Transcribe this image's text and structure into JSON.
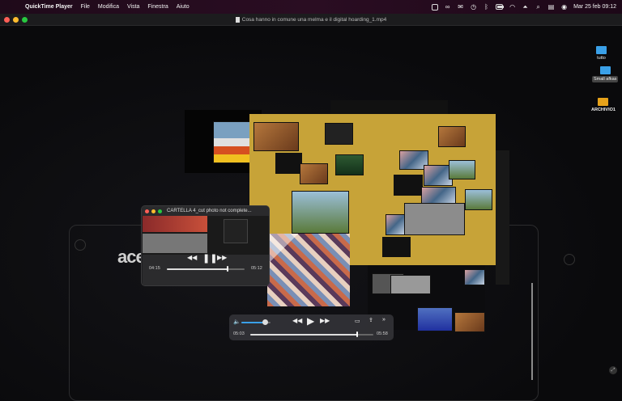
{
  "menubar": {
    "app_name": "QuickTime Player",
    "items": [
      "File",
      "Modifica",
      "Vista",
      "Finestra",
      "Aiuto"
    ],
    "datetime": "Mar 25 feb  09:12"
  },
  "window": {
    "title": "Cosa hanno in comune una melma e il digital hoarding_1.mp4"
  },
  "desktop": {
    "icons": [
      {
        "label": "tutto"
      },
      {
        "label": "Small afkas"
      },
      {
        "label": "ARCHIVIO1"
      }
    ],
    "logo_text": "acer"
  },
  "mini_player": {
    "title": "CARTELLA 4_cut photo not complete...",
    "time_current": "04:15",
    "time_total": "05:12",
    "progress": 0.78
  },
  "main_controls": {
    "time_current": "05:03",
    "time_total": "05:58",
    "progress": 0.87,
    "volume": 0.75
  },
  "colors": {
    "board": "#c7a338",
    "menubar": "#230b1d",
    "accent": "#3aa0e8"
  }
}
